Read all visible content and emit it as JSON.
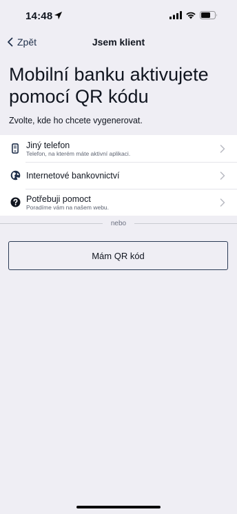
{
  "status_bar": {
    "time": "14:48",
    "icons": [
      "location-arrow-icon",
      "cellular-signal-icon",
      "wifi-icon",
      "battery-icon"
    ]
  },
  "nav": {
    "back_label": "Zpět",
    "title": "Jsem klient"
  },
  "page": {
    "title": "Mobilní banku aktivujete pomocí QR kódu",
    "subtitle": "Zvolte, kde ho chcete vygenerovat."
  },
  "options": [
    {
      "title": "Jiný telefon",
      "description": "Telefon, na kterém máte aktivní aplikaci.",
      "icon": "phone-icon"
    },
    {
      "title": "Internetové bankovnictví",
      "description": "",
      "icon": "globe-icon"
    },
    {
      "title": "Potřebuji pomoct",
      "description": "Poradíme vám na našem webu.",
      "icon": "help-icon"
    }
  ],
  "divider_label": "nebo",
  "qr_button_label": "Mám QR kód",
  "colors": {
    "background": "#EFEEF4",
    "text": "#10151F",
    "accent": "#1F2F4A"
  }
}
